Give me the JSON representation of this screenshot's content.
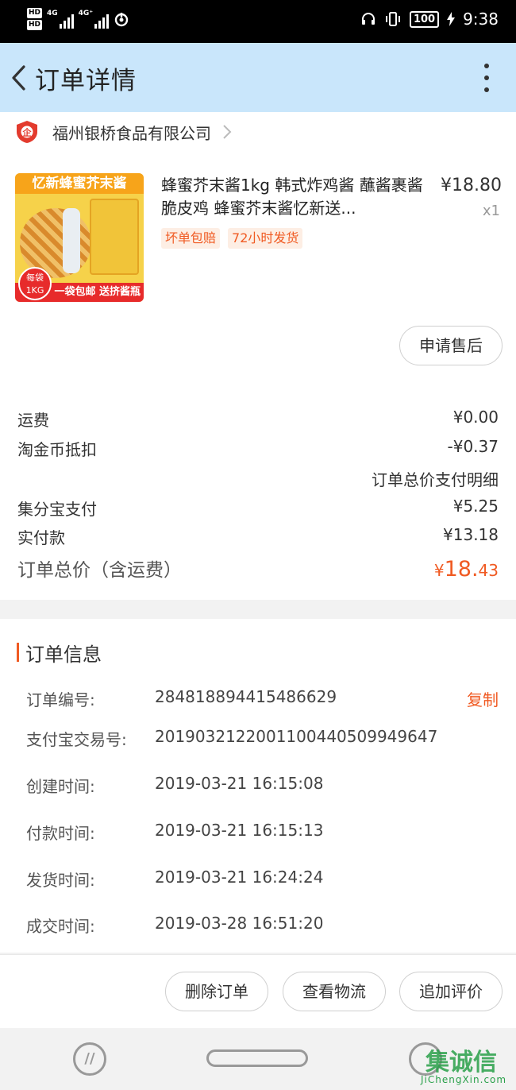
{
  "status_bar": {
    "hd1": "HD",
    "hd2": "HD",
    "net1": "4G",
    "net2": "4G⁺",
    "battery": "100",
    "time": "9:38"
  },
  "header": {
    "title": "订单详情"
  },
  "shop": {
    "name": "福州银桥食品有限公司"
  },
  "product": {
    "image_banner": "忆新蜂蜜芥末酱",
    "image_footer": "一袋包邮 送挤酱瓶",
    "image_badge": "每袋 1KG",
    "image_gift": "送",
    "title": "蜂蜜芥末酱1kg 韩式炸鸡酱 蘸酱裹酱 脆皮鸡 蜂蜜芥末酱忆新送...",
    "price": "¥18.80",
    "quantity": "x1",
    "tags": [
      "坏单包赔",
      "72小时发货"
    ],
    "after_sale_label": "申请售后"
  },
  "fees": {
    "shipping_label": "运费",
    "shipping_value": "¥0.00",
    "coin_label": "淘金币抵扣",
    "coin_value": "-¥0.37",
    "detail_link": "订单总价支付明细",
    "jifenbao_label": "集分宝支付",
    "jifenbao_value": "¥5.25",
    "paid_label": "实付款",
    "paid_value": "¥13.18",
    "total_label": "订单总价（含运费）",
    "total_currency": "¥",
    "total_integer": "18.",
    "total_decimal": "43"
  },
  "order_info": {
    "title": "订单信息",
    "copy_label": "复制",
    "rows": [
      {
        "label": "订单编号:",
        "value": "284818894415486629"
      },
      {
        "label": "支付宝交易号:",
        "value": "2019032122001100440509949647"
      },
      {
        "label": "创建时间:",
        "value": "2019-03-21 16:15:08"
      },
      {
        "label": "付款时间:",
        "value": "2019-03-21 16:15:13"
      },
      {
        "label": "发货时间:",
        "value": "2019-03-21 16:24:24"
      },
      {
        "label": "成交时间:",
        "value": "2019-03-28 16:51:20"
      }
    ]
  },
  "actions": {
    "delete": "删除订单",
    "logistics": "查看物流",
    "review": "追加评价"
  },
  "watermark": {
    "text": "集诚信",
    "sub": "JiChengXin.com"
  },
  "colors": {
    "accent": "#f05a22",
    "header_bg": "#c9e6fb"
  }
}
